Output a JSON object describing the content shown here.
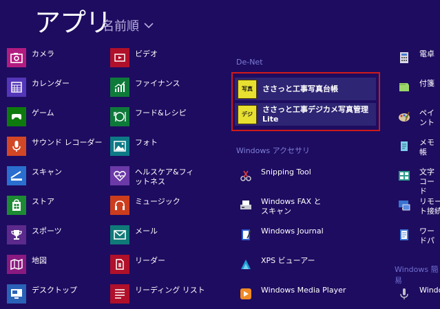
{
  "header": {
    "title": "アプリ",
    "sort_label": "名前順"
  },
  "col1": [
    {
      "label": "カメラ",
      "color": "#b21c80",
      "icon": "camera-icon"
    },
    {
      "label": "カレンダー",
      "color": "#5436b8",
      "icon": "calendar-icon"
    },
    {
      "label": "ゲーム",
      "color": "#0e7a0e",
      "icon": "gamepad-icon"
    },
    {
      "label": "サウンド レコーダー",
      "color": "#d24726",
      "icon": "microphone-icon"
    },
    {
      "label": "スキャン",
      "color": "#2a6fcf",
      "icon": "scanner-icon"
    },
    {
      "label": "ストア",
      "color": "#1d8a34",
      "icon": "store-icon"
    },
    {
      "label": "スポーツ",
      "color": "#5c2a8c",
      "icon": "trophy-icon"
    },
    {
      "label": "地図",
      "color": "#8a1a80",
      "icon": "map-icon"
    },
    {
      "label": "デスクトップ",
      "color": "#2a62b8",
      "icon": "desktop-icon"
    }
  ],
  "col2": [
    {
      "label": "ビデオ",
      "color": "#b0102a",
      "icon": "video-icon"
    },
    {
      "label": "ファイナンス",
      "color": "#0e7a3a",
      "icon": "finance-chart-icon"
    },
    {
      "label": "フード&レシピ",
      "color": "#0e7a3a",
      "icon": "food-icon"
    },
    {
      "label": "フォト",
      "color": "#0d7a86",
      "icon": "photo-icon"
    },
    {
      "label": "ヘルスケア&フィットネス",
      "color": "#6b3aa8",
      "icon": "health-heart-icon"
    },
    {
      "label": "ミュージック",
      "color": "#cc3d1e",
      "icon": "headphones-icon"
    },
    {
      "label": "メール",
      "color": "#0f7a78",
      "icon": "mail-icon"
    },
    {
      "label": "リーダー",
      "color": "#b0102a",
      "icon": "reader-icon"
    },
    {
      "label": "リーディング リスト",
      "color": "#b0102a",
      "icon": "reading-list-icon"
    }
  ],
  "group_denet": "De-Net",
  "denet_items": [
    {
      "label": "ささっと工事写真台帳",
      "badge": "写真",
      "icon": "photo-ledger-icon"
    },
    {
      "label": "ささっと工事デジカメ写真管理Lite",
      "badge": "デジ",
      "icon": "digicam-manager-icon"
    }
  ],
  "group_accessories": "Windows アクセサリ",
  "col3": [
    {
      "label": "Snipping Tool",
      "icon": "snipping-tool-icon"
    },
    {
      "label": "Windows FAX とスキャン",
      "icon": "fax-scan-icon"
    },
    {
      "label": "Windows Journal",
      "icon": "journal-icon"
    },
    {
      "label": "XPS ビューアー",
      "icon": "xps-viewer-icon"
    },
    {
      "label": "Windows Media Player",
      "icon": "media-player-icon"
    }
  ],
  "col4": [
    {
      "label": "電卓",
      "icon": "calculator-icon"
    },
    {
      "label": "付箋",
      "icon": "sticky-notes-icon"
    },
    {
      "label": "ペイント",
      "icon": "paint-icon"
    },
    {
      "label": "メモ帳",
      "icon": "notepad-icon"
    },
    {
      "label": "文字コード",
      "icon": "charmap-icon"
    },
    {
      "label": "リモート接続",
      "icon": "remote-desktop-icon"
    },
    {
      "label": "ワードパ",
      "icon": "wordpad-icon"
    }
  ],
  "group_system": "Windows 簡易",
  "col4_last": {
    "label": "Windo",
    "icon": "speech-microphone-icon"
  }
}
